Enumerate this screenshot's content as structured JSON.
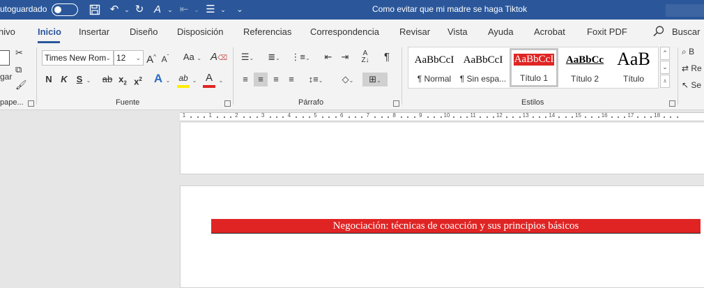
{
  "titlebar": {
    "autosave_label": "utoguardado",
    "document_title": "Como evitar que mi madre se haga Tiktok"
  },
  "tabs": [
    {
      "label": "hivo"
    },
    {
      "label": "Inicio",
      "active": true
    },
    {
      "label": "Insertar"
    },
    {
      "label": "Diseño"
    },
    {
      "label": "Disposición"
    },
    {
      "label": "Referencias"
    },
    {
      "label": "Correspondencia"
    },
    {
      "label": "Revisar"
    },
    {
      "label": "Vista"
    },
    {
      "label": "Ayuda"
    },
    {
      "label": "Acrobat"
    },
    {
      "label": "Foxit PDF"
    }
  ],
  "search_label": "Buscar",
  "clipboard": {
    "paste_label": "gar",
    "group_label": "pape..."
  },
  "font": {
    "font_name": "Times New Rom",
    "font_size": "12",
    "grow_label": "A",
    "shrink_label": "A",
    "case_label": "Aa",
    "clear_label": "A",
    "bold": "N",
    "italic": "K",
    "underline": "S",
    "strike": "ab",
    "subscript": "x",
    "superscript": "x",
    "text_effect": "A",
    "highlight_label": "ab",
    "font_color_label": "A",
    "group_label": "Fuente"
  },
  "paragraph": {
    "group_label": "Párrafo",
    "pilcrow": "¶"
  },
  "styles": {
    "items": [
      {
        "preview": "AaBbCcI",
        "name": "¶ Normal"
      },
      {
        "preview": "AaBbCcI",
        "name": "¶ Sin espa..."
      },
      {
        "preview": "AaBbCcI",
        "name": "Título 1",
        "selected": true
      },
      {
        "preview": "AaBbCc",
        "name": "Título 2"
      },
      {
        "preview": "AaB",
        "name": "Título"
      }
    ],
    "group_label": "Estilos"
  },
  "editing": {
    "find_label": "B",
    "replace_label": "Re",
    "select_label": "Se"
  },
  "ruler": {
    "numbers": [
      "1",
      "1",
      "2",
      "3",
      "4",
      "5",
      "6",
      "7",
      "8",
      "9",
      "10",
      "11",
      "12",
      "13",
      "14",
      "15",
      "16",
      "17",
      "18"
    ]
  },
  "document": {
    "heading": "Negociación: técnicas de coacción y sus principios básicos"
  },
  "colors": {
    "brand": "#2b579a",
    "heading_band": "#e02424",
    "highlight_yellow": "#ffee00",
    "font_color_red": "#e02424",
    "text_effect_blue": "#2b6cc4"
  }
}
